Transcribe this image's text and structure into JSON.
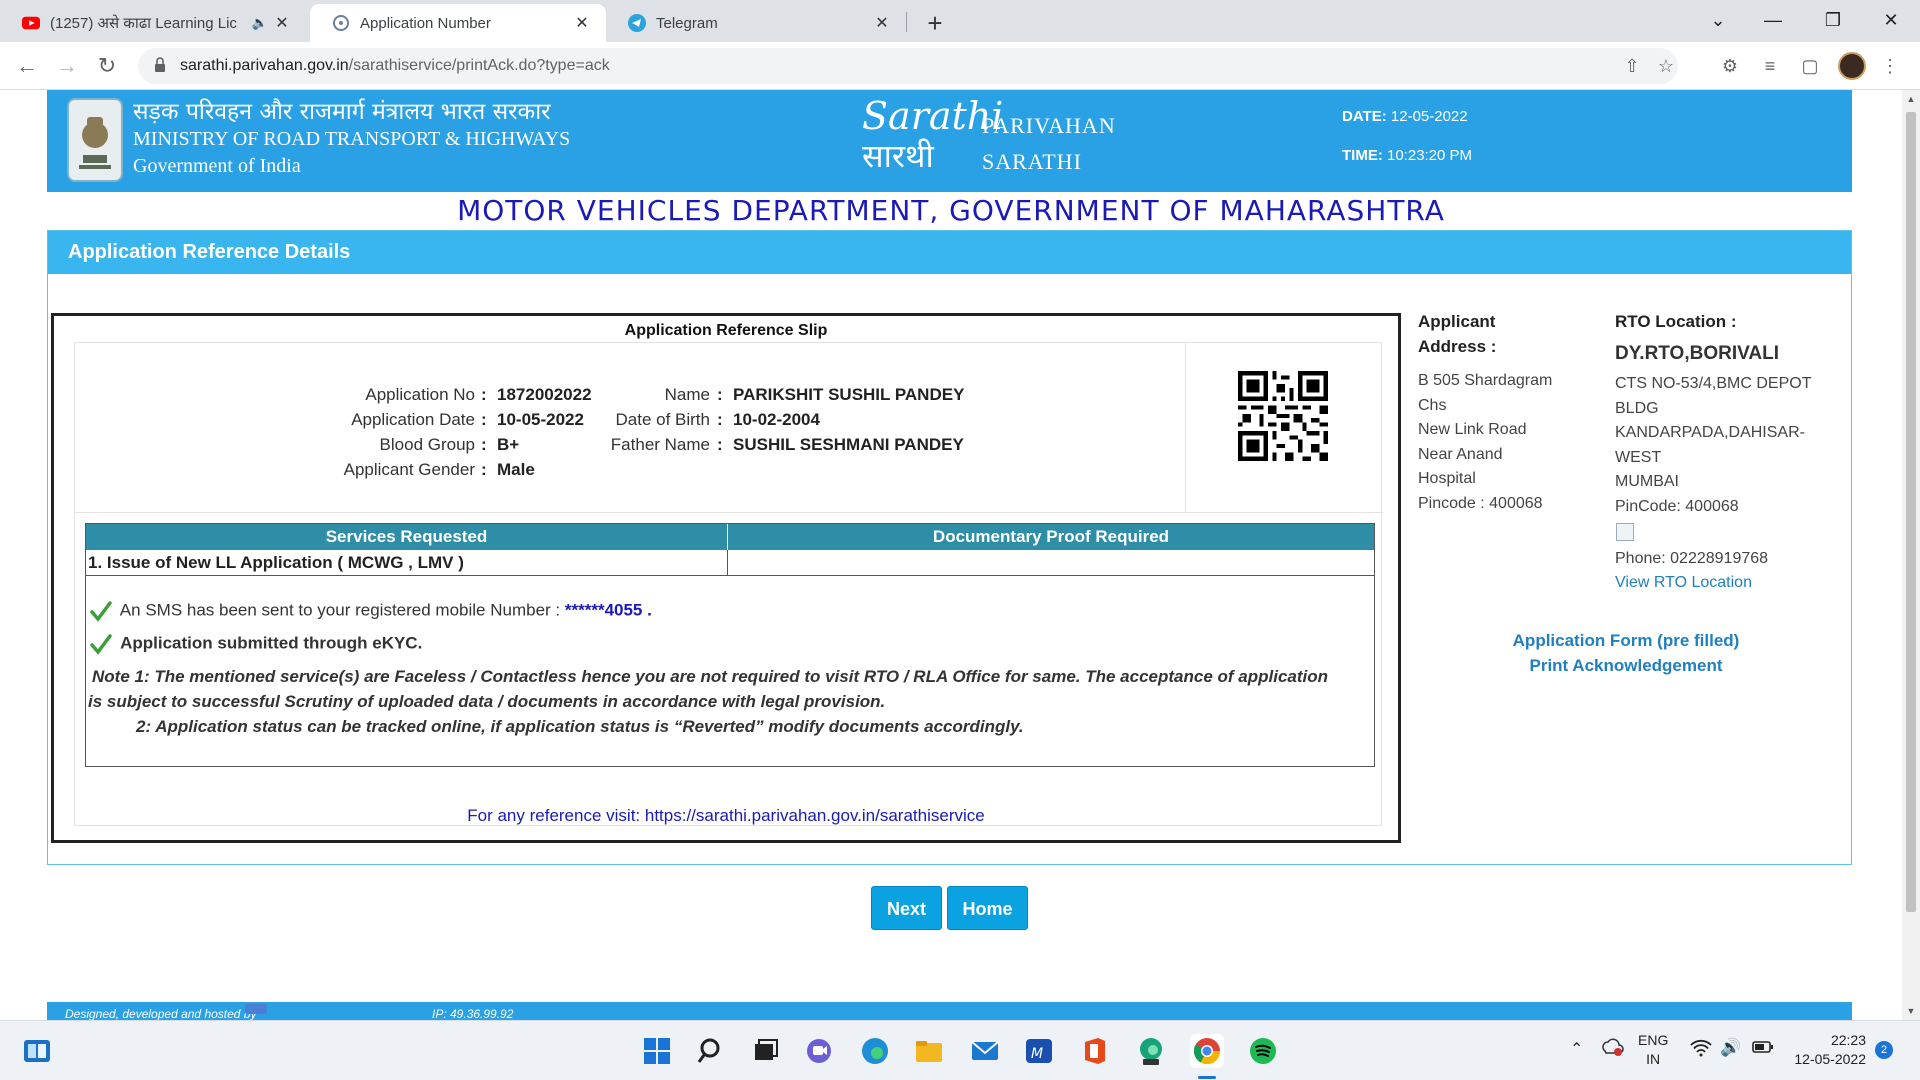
{
  "browser": {
    "tabs": [
      {
        "title": "(1257) असे काढा Learning Lic",
        "icon": "youtube-icon"
      },
      {
        "title": "Application Number",
        "icon": "sarathi-icon"
      },
      {
        "title": "Telegram",
        "icon": "telegram-icon"
      }
    ],
    "url_domain": "sarathi.parivahan.gov.in",
    "url_path": "/sarathiservice/printAck.do?type=ack"
  },
  "header": {
    "ministry_hindi": "सड़क परिवहन और राजमार्ग मंत्रालय भारत सरकार",
    "ministry_english": "MINISTRY OF ROAD TRANSPORT & HIGHWAYS",
    "government": "Government of India",
    "logo_english": "Sarathi",
    "logo_hindi": "सारथी",
    "brand_line1": "PARIVAHAN",
    "brand_line2": "SARATHI",
    "date_label": "DATE:",
    "date_value": "12-05-2022",
    "time_label": "TIME:",
    "time_value": "10:23:20 PM"
  },
  "department": "MOTOR VEHICLES DEPARTMENT, GOVERNMENT OF MAHARASHTRA",
  "panel": {
    "title": "Application Reference Details"
  },
  "slip": {
    "title": "Application Reference Slip",
    "application_no_label": "Application No",
    "application_no": "1872002022",
    "application_date_label": "Application Date",
    "application_date": "10-05-2022",
    "blood_group_label": "Blood Group",
    "blood_group": "B+",
    "gender_label": "Applicant Gender",
    "gender": "Male",
    "name_label": "Name",
    "name": "PARIKSHIT SUSHIL PANDEY",
    "dob_label": "Date of Birth",
    "dob": "10-02-2004",
    "father_label": "Father Name",
    "father": "SUSHIL SESHMANI PANDEY",
    "colon": ":"
  },
  "services": {
    "col1": "Services Requested",
    "col2": "Documentary Proof Required",
    "rows": [
      {
        "service": "1. Issue of New LL Application ( MCWG , LMV )",
        "proof": ""
      }
    ]
  },
  "messages": {
    "sms_text": "An SMS has been sent to your registered mobile Number :",
    "sms_number": "******4055",
    "sms_end": ".",
    "ekyc": "Application submitted through eKYC.",
    "note1": "Note 1:  The mentioned service(s) are Faceless / Contactless hence you are not required to visit RTO / RLA Office for same. The acceptance of application",
    "note1b": "is subject to successful Scrutiny of uploaded data / documents in accordance with legal provision.",
    "note2": "2:  Application status can be tracked online, if application status is “Reverted” modify documents accordingly.",
    "reference": "For any reference visit: https://sarathi.parivahan.gov.in/sarathiservice"
  },
  "address": {
    "label1": "Applicant",
    "label2": "Address :",
    "lines": [
      "B 505 Shardagram",
      "Chs",
      "New Link Road",
      "Near Anand",
      "Hospital",
      "Pincode : 400068"
    ]
  },
  "rto": {
    "label": "RTO Location :",
    "name": "DY.RTO,BORIVALI",
    "lines": [
      "CTS NO-53/4,BMC DEPOT",
      "BLDG",
      "KANDARPADA,DAHISAR-",
      "WEST",
      "MUMBAI",
      "PinCode:  400068"
    ],
    "phone": "Phone:  02228919768",
    "view_link": "View RTO Location"
  },
  "links": {
    "form": "Application Form (pre filled)",
    "print": "Print Acknowledgement"
  },
  "buttons": {
    "next": "Next",
    "home": "Home"
  },
  "footer": {
    "designed": "Designed, developed and hosted by",
    "ip": "IP: 49.36.99.92"
  },
  "taskbar": {
    "lang1": "ENG",
    "lang2": "IN",
    "time": "22:23",
    "date": "12-05-2022",
    "notifications": "2"
  }
}
